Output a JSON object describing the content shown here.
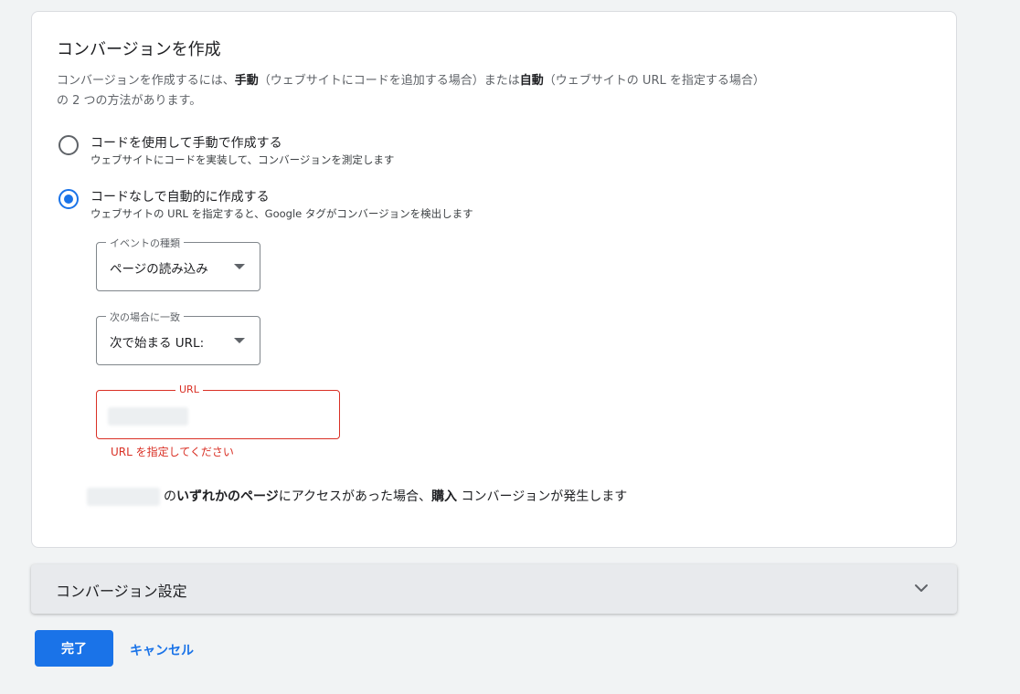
{
  "card": {
    "title": "コンバージョンを作成",
    "desc_part1": "コンバージョンを作成するには、",
    "desc_bold1": "手動",
    "desc_part2": "（ウェブサイトにコードを追加する場合）または",
    "desc_bold2": "自動",
    "desc_part3": "（ウェブサイトの URL を指定する場合）",
    "desc_line2": "の 2 つの方法があります。"
  },
  "options": [
    {
      "label": "コードを使用して手動で作成する",
      "sub": "ウェブサイトにコードを実装して、コンバージョンを測定します",
      "checked": false
    },
    {
      "label": "コードなしで自動的に作成する",
      "sub": "ウェブサイトの URL を指定すると、Google タグがコンバージョンを検出します",
      "checked": true
    }
  ],
  "event_type": {
    "legend": "イベントの種類",
    "value": "ページの読み込み"
  },
  "match_type": {
    "legend": "次の場合に一致",
    "value": "次で始まる URL:"
  },
  "url_field": {
    "legend": "URL",
    "value": "",
    "error": "URL を指定してください"
  },
  "summary": {
    "part1": "の",
    "bold1": "いずれかのページ",
    "part2": "にアクセスがあった場合、",
    "bold2": "購入",
    "part3": " コンバージョンが発生します"
  },
  "settings": {
    "title": "コンバージョン設定"
  },
  "actions": {
    "done": "完了",
    "cancel": "キャンセル"
  },
  "colors": {
    "accent": "#1a73e8",
    "error": "#d93025"
  }
}
